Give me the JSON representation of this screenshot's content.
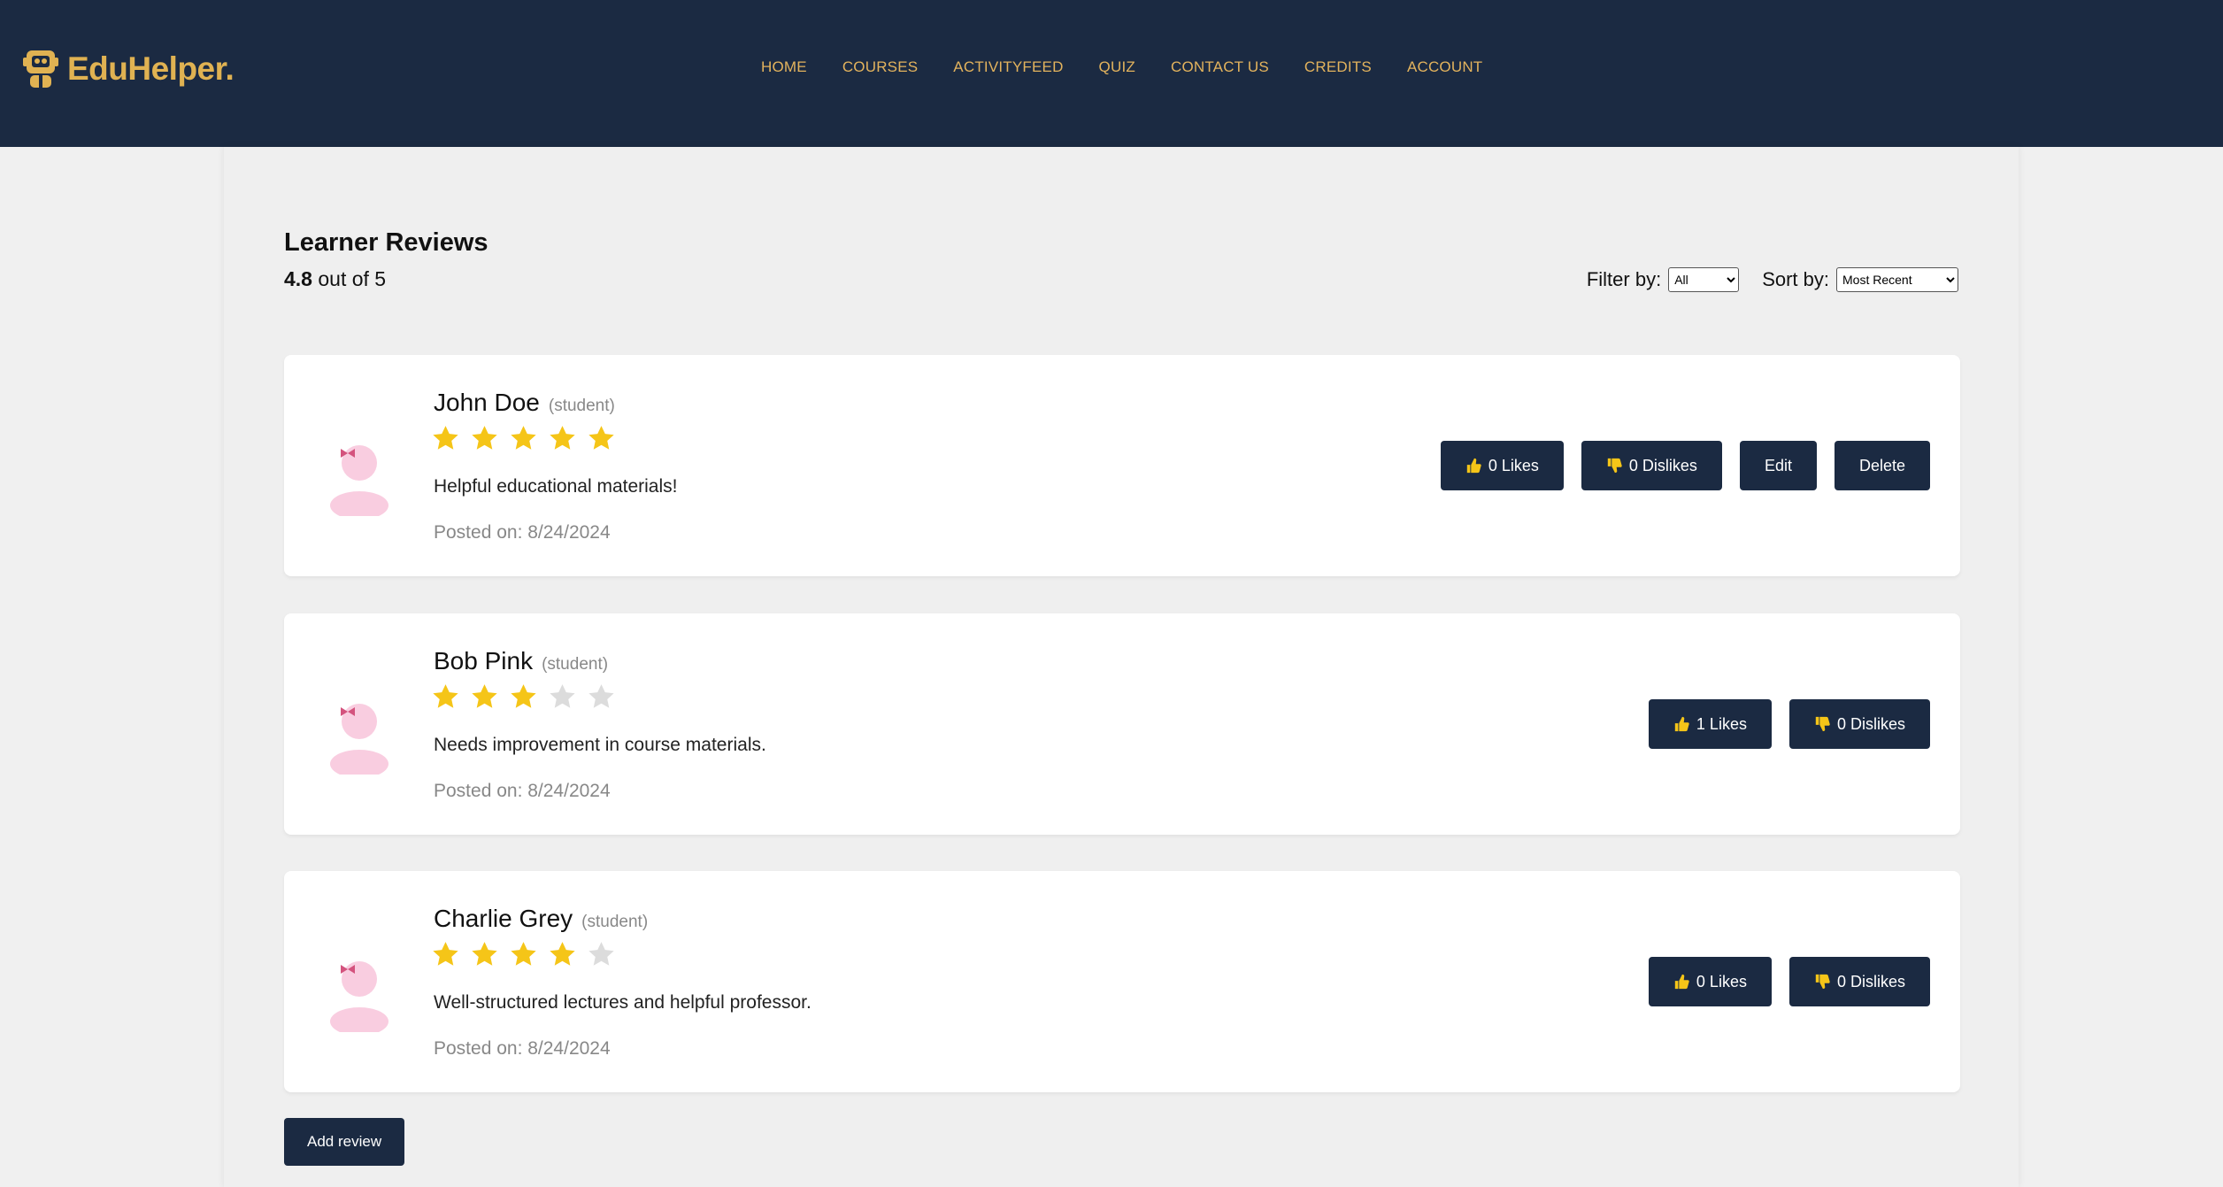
{
  "brand": {
    "name": "EduHelper.",
    "accent": "#e0b252",
    "navy": "#1b2a42"
  },
  "nav": [
    "HOME",
    "COURSES",
    "ACTIVITYFEED",
    "QUIZ",
    "CONTACT US",
    "CREDITS",
    "ACCOUNT"
  ],
  "page": {
    "heading": "Learner Reviews",
    "average": "4.8",
    "average_suffix": " out of 5",
    "filter_label": "Filter by:",
    "filter_value": "All",
    "sort_label": "Sort by:",
    "sort_value": "Most Recent",
    "add_review": "Add review"
  },
  "reviews": [
    {
      "name": "John Doe",
      "role": "(student)",
      "rating": 5,
      "text": "Helpful educational materials!",
      "date": "Posted on: 8/24/2024",
      "likes": "0 Likes",
      "dislikes": "0 Dislikes",
      "edit": "Edit",
      "delete": "Delete"
    },
    {
      "name": "Bob Pink",
      "role": "(student)",
      "rating": 3,
      "text": "Needs improvement in course materials.",
      "date": "Posted on: 8/24/2024",
      "likes": "1 Likes",
      "dislikes": "0 Dislikes"
    },
    {
      "name": "Charlie Grey",
      "role": "(student)",
      "rating": 4,
      "text": "Well-structured lectures and helpful professor.",
      "date": "Posted on: 8/24/2024",
      "likes": "0 Likes",
      "dislikes": "0 Dislikes"
    }
  ],
  "icons": {
    "like": "thumbs-up-icon",
    "dislike": "thumbs-down-icon",
    "star": "star-icon",
    "avatar": "avatar-icon"
  },
  "colors": {
    "star_on": "#f5c518",
    "star_off": "#dcdcdc",
    "avatar_pink": "#f9cde0",
    "bow": "#d4537e"
  }
}
